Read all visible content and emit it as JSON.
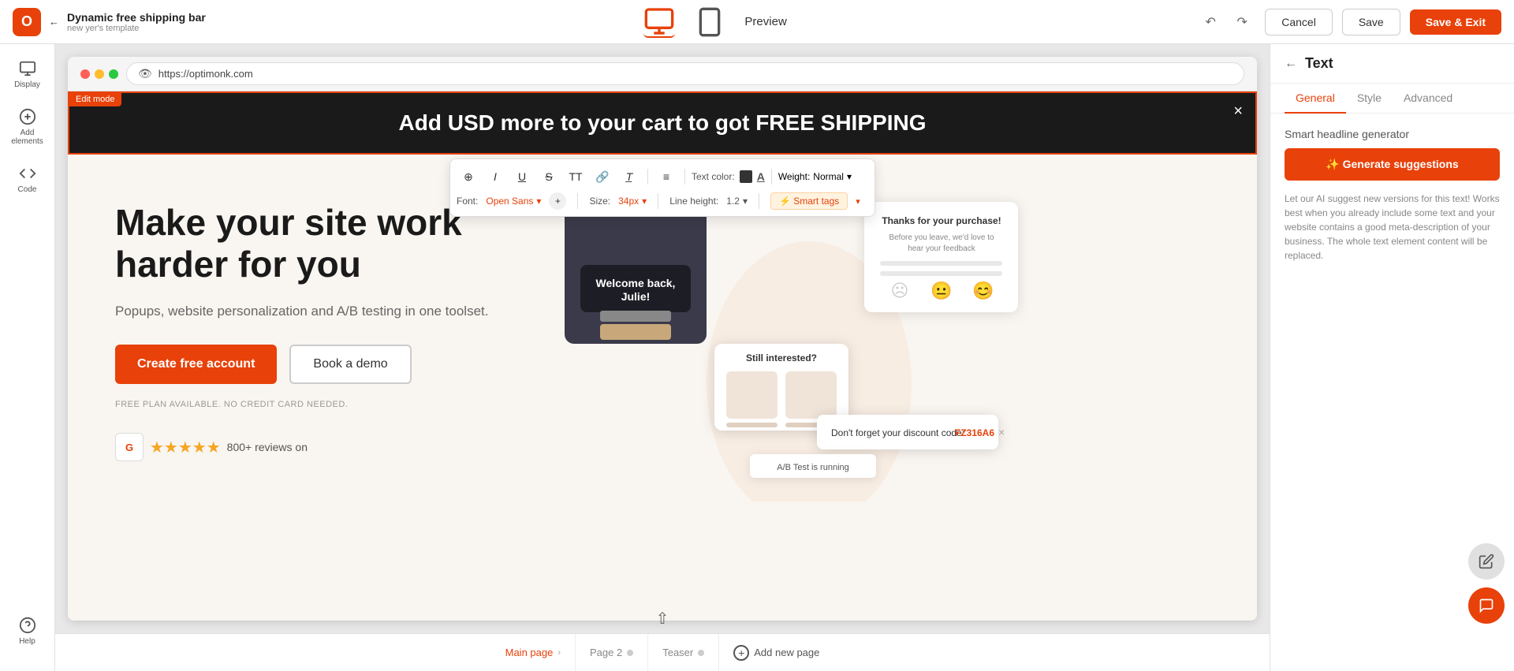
{
  "topbar": {
    "back_label": "Back",
    "template_title": "Dynamic free shipping bar",
    "template_sub": "new yer's template",
    "logo_text": "O",
    "preview_label": "Preview",
    "cancel_label": "Cancel",
    "save_label": "Save",
    "save_exit_label": "Save & Exit"
  },
  "left_sidebar": {
    "items": [
      {
        "id": "display",
        "label": "Display"
      },
      {
        "id": "add-elements",
        "label": "Add elements"
      },
      {
        "id": "code",
        "label": "Code"
      },
      {
        "id": "help",
        "label": "Help"
      }
    ]
  },
  "browser": {
    "url": "https://optimonk.com"
  },
  "edit_mode_badge": "Edit mode",
  "shipping_bar": {
    "text": "Add USD more to your cart to got FREE SHIPPING",
    "close_label": "×"
  },
  "toolbar": {
    "row1_btns": [
      "⊕",
      "I",
      "U",
      "S",
      "TT",
      "🔗",
      "T̲",
      "≡"
    ],
    "text_color_label": "Text color:",
    "weight_label": "Weight:",
    "weight_value": "Normal",
    "font_label": "Font:",
    "font_value": "Open Sans",
    "size_label": "Size:",
    "size_value": "34px",
    "line_height_label": "Line height:",
    "line_height_value": "1.2",
    "smart_tags_label": "⚡ Smart tags"
  },
  "landing": {
    "heading": "Make your site work harder for you",
    "sub": "Popups, website personalization and A/B testing in one toolset.",
    "cta_primary": "Create free account",
    "cta_secondary": "Book a demo",
    "free_plan_note": "FREE PLAN AVAILABLE. NO CREDIT CARD NEEDED.",
    "stars": "★★★★★",
    "reviews_label": "800+ reviews on",
    "g2_label": "G"
  },
  "right_panel": {
    "title": "Text",
    "tabs": [
      "General",
      "Style",
      "Advanced"
    ],
    "active_tab": "General",
    "smart_headline_label": "Smart headline generator",
    "generate_btn_label": "✨ Generate suggestions",
    "ai_description": "Let our AI suggest new versions for this text! Works best when you already include some text and your website contains a good meta-description of your business. The whole text element content will be replaced."
  },
  "bottom_bar": {
    "pages": [
      {
        "id": "main-page",
        "label": "Main page",
        "active": true
      },
      {
        "id": "page-2",
        "label": "Page 2",
        "active": false
      },
      {
        "id": "teaser",
        "label": "Teaser",
        "active": false
      }
    ],
    "add_page_label": "Add new page"
  }
}
